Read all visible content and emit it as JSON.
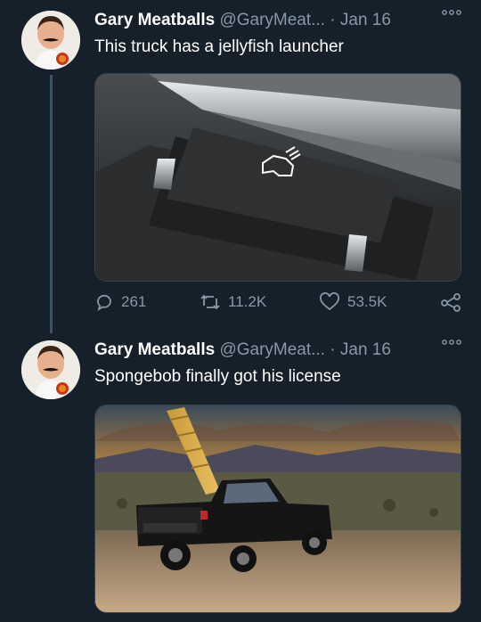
{
  "tweets": [
    {
      "author_name": "Gary Meatballs",
      "handle": "@GaryMeat...",
      "separator": "·",
      "date": "Jan 16",
      "text": "This truck has a jellyfish launcher",
      "replies": "261",
      "retweets": "11.2K",
      "likes": "53.5K"
    },
    {
      "author_name": "Gary Meatballs",
      "handle": "@GaryMeat...",
      "separator": "·",
      "date": "Jan 16",
      "text": "Spongebob finally got his license"
    }
  ],
  "icons": {
    "more": "more-options-icon",
    "reply": "reply-icon",
    "retweet": "retweet-icon",
    "like": "heart-icon",
    "share": "share-icon"
  },
  "colors": {
    "background": "#15202b",
    "secondary_text": "#8899a6",
    "thread_line": "#3d5466"
  }
}
